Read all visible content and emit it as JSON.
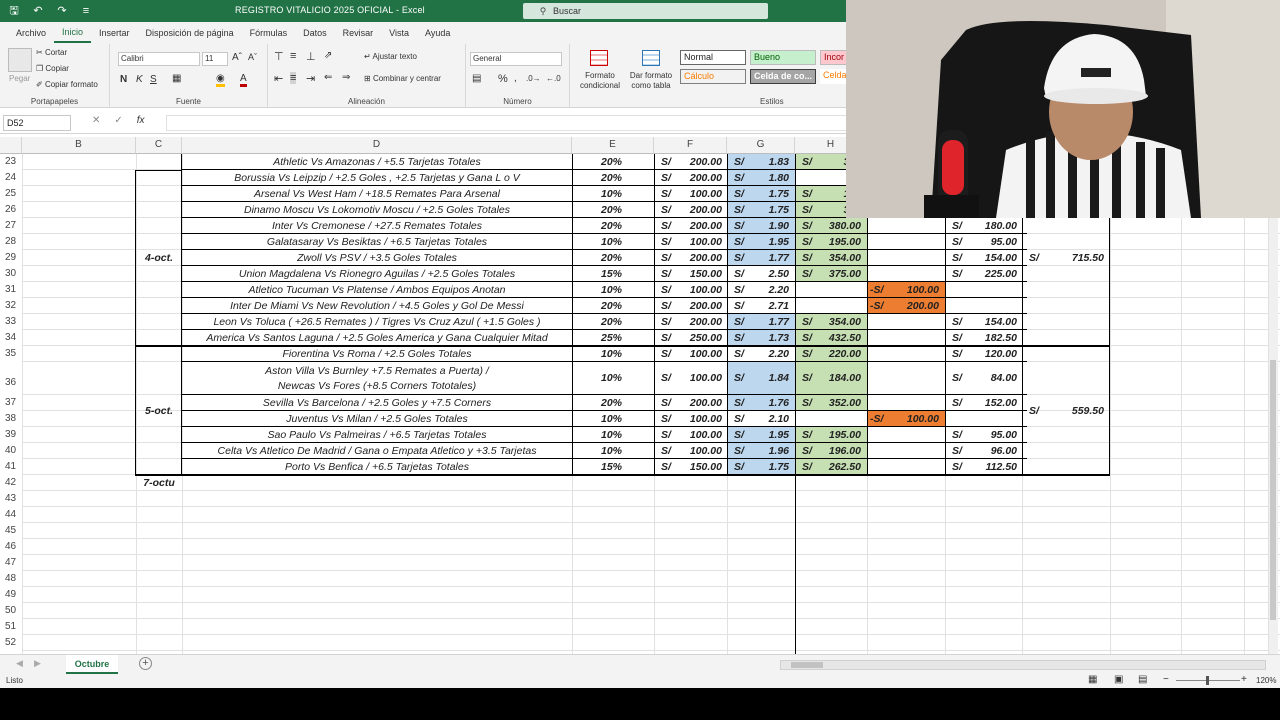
{
  "app": {
    "title": "REGISTRO VITALICIO 2025 OFICIAL  -  Excel",
    "search_placeholder": "Buscar"
  },
  "menu": [
    "Archivo",
    "Inicio",
    "Insertar",
    "Disposición de página",
    "Fórmulas",
    "Datos",
    "Revisar",
    "Vista",
    "Ayuda"
  ],
  "ribbon": {
    "clipboard": {
      "paste": "Pegar",
      "cut": "Cortar",
      "copy": "Copiar",
      "format_painter": "Copiar formato",
      "label": "Portapapeles"
    },
    "font": {
      "name": "Calibri",
      "size": "11",
      "bold": "N",
      "italic": "K",
      "underline": "S",
      "label": "Fuente"
    },
    "alignment": {
      "wrap": "Ajustar texto",
      "merge": "Combinar y centrar",
      "label": "Alineación"
    },
    "number": {
      "format": "General",
      "label": "Número"
    },
    "styles": {
      "cond_format": "Formato condicional",
      "table_format": "Dar formato como tabla",
      "normal": "Normal",
      "good": "Bueno",
      "bad": "Incor",
      "calc": "Cálculo",
      "check": "Celda de co...",
      "linked": "Celda",
      "label": "Estilos"
    }
  },
  "formula_bar": {
    "name_box": "D52",
    "fx": "fx"
  },
  "columns": [
    "B",
    "C",
    "D",
    "E",
    "F",
    "G",
    "H"
  ],
  "rows": {
    "23": {
      "D": "Athletic Vs Amazonas / +5.5 Tarjetas  Totales",
      "E": "20%",
      "F": "200.00",
      "G": "1.83",
      "H": "366"
    },
    "24": {
      "D": "Borussia Vs Leipzip / +2.5 Goles , +2.5 Tarjetas y Gana L o V",
      "E": "20%",
      "F": "200.00",
      "G": "1.80"
    },
    "25": {
      "D": "Arsenal Vs West Ham / +18.5 Remates Para Arsenal",
      "E": "10%",
      "F": "100.00",
      "G": "1.75",
      "H": "175"
    },
    "26": {
      "D": "Dinamo Moscu Vs Lokomotiv Moscu / +2.5 Goles Totales",
      "E": "20%",
      "F": "200.00",
      "G": "1.75",
      "H": "350"
    },
    "27": {
      "D": "Inter Vs Cremonese / +27.5 Remates Totales",
      "E": "20%",
      "F": "200.00",
      "G": "1.90",
      "H": "380.00",
      "J": "180.00"
    },
    "28": {
      "D": "Galatasaray Vs Besiktas / +6.5 Tarjetas Totales",
      "E": "10%",
      "F": "100.00",
      "G": "1.95",
      "H": "195.00",
      "J": "95.00"
    },
    "29": {
      "C": "4-oct.",
      "D": "Zwoll Vs PSV / +3.5 Goles Totales",
      "E": "20%",
      "F": "200.00",
      "G": "1.77",
      "H": "354.00",
      "J": "154.00",
      "K": "715.50"
    },
    "30": {
      "D": "Union Magdalena Vs Rionegro Aguilas / +2.5 Goles Totales",
      "E": "15%",
      "F": "150.00",
      "G": "2.50",
      "H": "375.00",
      "J": "225.00"
    },
    "31": {
      "D": "Atletico Tucuman Vs Platense / Ambos Equipos Anotan",
      "E": "10%",
      "F": "100.00",
      "G": "2.20",
      "I": "100.00"
    },
    "32": {
      "D": "Inter De Miami Vs New Revolution / +4.5 Goles y Gol De Messi",
      "E": "20%",
      "F": "200.00",
      "G": "2.71",
      "I": "200.00"
    },
    "33": {
      "D": "Leon Vs Toluca ( +26.5 Remates ) / Tigres Vs Cruz Azul ( +1.5 Goles )",
      "E": "20%",
      "F": "200.00",
      "G": "1.77",
      "H": "354.00",
      "J": "154.00"
    },
    "34": {
      "D": "America Vs Santos Laguna / +2.5 Goles America y Gana Cualquier Mitad",
      "E": "25%",
      "F": "250.00",
      "G": "1.73",
      "H": "432.50",
      "J": "182.50"
    },
    "35": {
      "D": "Fiorentina Vs Roma / +2.5 Goles Totales",
      "E": "10%",
      "F": "100.00",
      "G": "2.20",
      "H": "220.00",
      "J": "120.00"
    },
    "36": {
      "D1": "Aston Villa Vs Burnley  +7.5 Remates a Puerta) /",
      "D2": "Newcas Vs Fores (+8.5 Corners Tototales)",
      "E": "10%",
      "F": "100.00",
      "G": "1.84",
      "H": "184.00",
      "J": "84.00"
    },
    "37": {
      "D": "Sevilla Vs Barcelona / +2.5 Goles y +7.5 Corners",
      "E": "20%",
      "F": "200.00",
      "G": "1.76",
      "H": "352.00",
      "J": "152.00",
      "K": "559.50"
    },
    "38": {
      "C": "5-oct.",
      "D": "Juventus Vs Milan / +2.5 Goles Totales",
      "E": "10%",
      "F": "100.00",
      "G": "2.10",
      "I": "100.00"
    },
    "39": {
      "D": "Sao Paulo Vs Palmeiras / +6.5 Tarjetas Totales",
      "E": "10%",
      "F": "100.00",
      "G": "1.95",
      "H": "195.00",
      "J": "95.00"
    },
    "40": {
      "D": "Celta Vs Atletico De Madrid / Gana o Empata Atletico y +3.5 Tarjetas",
      "E": "10%",
      "F": "100.00",
      "G": "1.96",
      "H": "196.00",
      "J": "96.00"
    },
    "41": {
      "D": "Porto Vs Benfica / +6.5 Tarjetas Totales",
      "E": "15%",
      "F": "150.00",
      "G": "1.75",
      "H": "262.50",
      "J": "112.50"
    },
    "42": {
      "C": "7-octu"
    }
  },
  "row_numbers": [
    "23",
    "24",
    "25",
    "26",
    "27",
    "28",
    "29",
    "30",
    "31",
    "32",
    "33",
    "34",
    "35",
    "36",
    "37",
    "38",
    "39",
    "40",
    "41",
    "42",
    "43",
    "44",
    "45",
    "46",
    "47",
    "48",
    "49",
    "50",
    "51",
    "52"
  ],
  "currency": "S/",
  "neg_currency": "-S/",
  "sheet": {
    "tab": "Octubre",
    "add": "+"
  },
  "status": {
    "ready": "Listo",
    "zoom": "120%"
  },
  "colors": {
    "excel_green": "#217346",
    "blue_fill": "#bdd7ee",
    "green_fill": "#c6e0b4",
    "orange_fill": "#ed7d31"
  }
}
